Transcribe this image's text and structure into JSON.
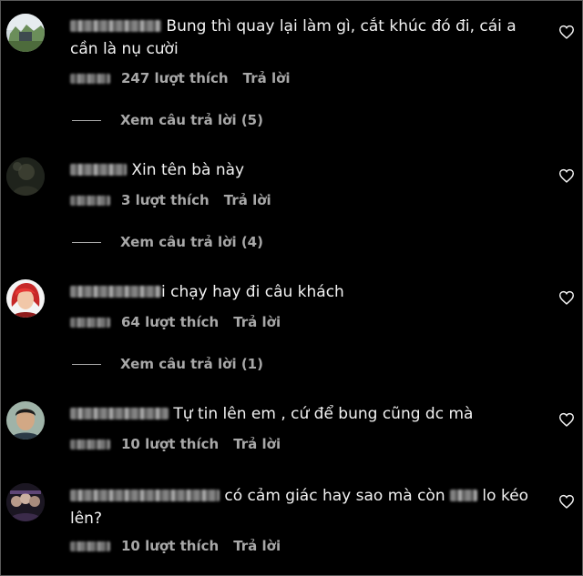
{
  "comments": [
    {
      "text": "Bung thì quay lại làm gì, cắt khúc đó đi, cái a cần là nụ cười",
      "likes": "247 lượt thích",
      "reply": "Trả lời",
      "view_replies": "Xem câu trả lời (5)",
      "avatar": "landscape-avatar"
    },
    {
      "text": "Xin tên bà này",
      "likes": "3 lượt thích",
      "reply": "Trả lời",
      "view_replies": "Xem câu trả lời (4)",
      "avatar": "dark-avatar"
    },
    {
      "text_prefix": "i",
      "text": "chạy hay đi câu khách",
      "likes": "64 lượt thích",
      "reply": "Trả lời",
      "view_replies": "Xem câu trả lời (1)",
      "avatar": "red-hair-avatar"
    },
    {
      "text": "Tự tin lên em , cứ để bung cũng dc mà",
      "likes": "10 lượt thích",
      "reply": "Trả lời",
      "avatar": "man-avatar"
    },
    {
      "text_part1": "có cảm giác hay sao mà còn",
      "text_part2": "lo kéo",
      "text_line2": "lên?",
      "likes": "10 lượt thích",
      "reply": "Trả lời",
      "avatar": "group-avatar"
    }
  ],
  "colors": {
    "background": "#000000",
    "text": "#f2f2f2",
    "secondary": "#a8a8a8"
  },
  "icons": {
    "like": "heart-outline-icon"
  }
}
